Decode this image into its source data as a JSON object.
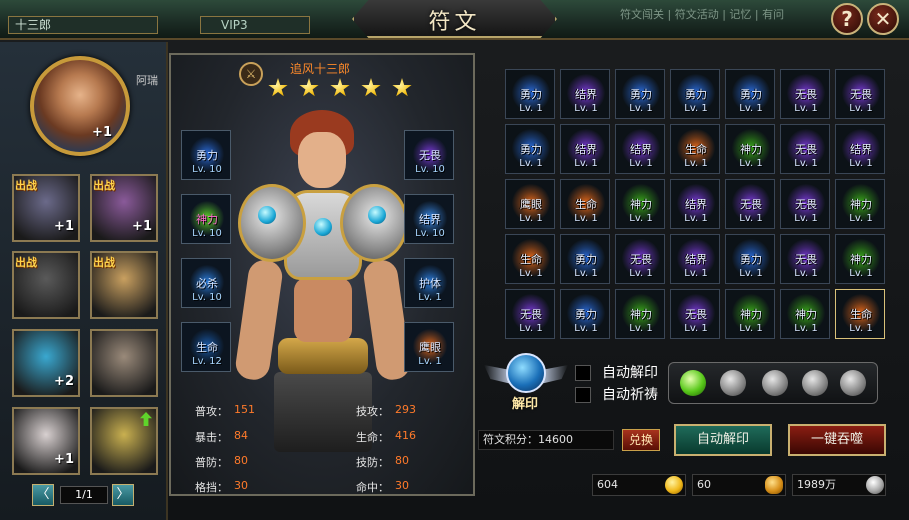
{
  "header": {
    "player_name": "十三郎",
    "vip": "VIP3",
    "title": "符文",
    "bg_text": "符文闯关 | 符文活动 | 记忆 | 有问",
    "help_label": "?",
    "close_label": "✕"
  },
  "left": {
    "main_hero": {
      "plus": "+1",
      "name": "阿瑞"
    },
    "heroes": [
      {
        "tag": "出战",
        "plus": "+1",
        "color": "#6b6a8a"
      },
      {
        "tag": "出战",
        "plus": "+1",
        "color": "#8a5a9a"
      },
      {
        "tag": "出战",
        "plus": "",
        "color": "#5a5a5a"
      },
      {
        "tag": "出战",
        "plus": "",
        "color": "#c9a060"
      },
      {
        "tag": "",
        "plus": "+2",
        "color": "#3aa8d0"
      },
      {
        "tag": "",
        "plus": "",
        "color": "#9a8a7a"
      },
      {
        "tag": "",
        "plus": "+1",
        "color": "#d8d0d0"
      },
      {
        "tag": "",
        "plus": "",
        "color": "#c9b050",
        "upgrade": true
      }
    ],
    "pager": {
      "prev": "〈",
      "text": "1/1",
      "next": "〉"
    }
  },
  "hero": {
    "name": "追风十三郎",
    "stars": 5,
    "equip": [
      {
        "name": "勇力",
        "lv": "Lv. 10",
        "color": "#2a6ad8",
        "name_color": "#d8e6ff"
      },
      {
        "name": "神力",
        "lv": "Lv. 10",
        "color": "#5fd42a",
        "name_color": "#ff6ad0"
      },
      {
        "name": "必杀",
        "lv": "Lv. 10",
        "color": "#2a7ad8",
        "name_color": "#d8e6ff"
      },
      {
        "name": "生命",
        "lv": "Lv. 12",
        "color": "#1a5aa8",
        "name_color": "#d8e6ff"
      },
      {
        "name": "无畏",
        "lv": "Lv. 10",
        "color": "#7a3ad8",
        "name_color": "#d8e6ff"
      },
      {
        "name": "结界",
        "lv": "Lv. 10",
        "color": "#3a8ae8",
        "name_color": "#d8e6ff"
      },
      {
        "name": "护体",
        "lv": "Lv. 1",
        "color": "#2a7ad8",
        "name_color": "#d8e6ff"
      },
      {
        "name": "鹰眼",
        "lv": "Lv. 1",
        "color": "#e0661a",
        "name_color": "#d8e6ff"
      }
    ],
    "stats": [
      {
        "label": "普攻：",
        "value": "151"
      },
      {
        "label": "技攻：",
        "value": "293"
      },
      {
        "label": "暴击：",
        "value": "84"
      },
      {
        "label": "生命：",
        "value": "416"
      },
      {
        "label": "普防：",
        "value": "80"
      },
      {
        "label": "技防：",
        "value": "80"
      },
      {
        "label": "格挡：",
        "value": "30"
      },
      {
        "label": "命中：",
        "value": "30"
      }
    ]
  },
  "runes": [
    {
      "name": "勇力",
      "lv": "Lv. 1",
      "color": "#2a6ad8"
    },
    {
      "name": "结界",
      "lv": "Lv. 1",
      "color": "#7a3ad8"
    },
    {
      "name": "勇力",
      "lv": "Lv. 1",
      "color": "#2a6ad8"
    },
    {
      "name": "勇力",
      "lv": "Lv. 1",
      "color": "#2a6ad8"
    },
    {
      "name": "勇力",
      "lv": "Lv. 1",
      "color": "#2a6ad8"
    },
    {
      "name": "无畏",
      "lv": "Lv. 1",
      "color": "#7a3ad8"
    },
    {
      "name": "无畏",
      "lv": "Lv. 1",
      "color": "#7a3ad8"
    },
    {
      "name": "勇力",
      "lv": "Lv. 1",
      "color": "#2a6ad8"
    },
    {
      "name": "结界",
      "lv": "Lv. 1",
      "color": "#7a3ad8"
    },
    {
      "name": "结界",
      "lv": "Lv. 1",
      "color": "#7a3ad8"
    },
    {
      "name": "生命",
      "lv": "Lv. 1",
      "color": "#e0661a"
    },
    {
      "name": "神力",
      "lv": "Lv. 1",
      "color": "#3aa81a"
    },
    {
      "name": "无畏",
      "lv": "Lv. 1",
      "color": "#7a3ad8"
    },
    {
      "name": "结界",
      "lv": "Lv. 1",
      "color": "#7a3ad8"
    },
    {
      "name": "鹰眼",
      "lv": "Lv. 1",
      "color": "#e0661a"
    },
    {
      "name": "生命",
      "lv": "Lv. 1",
      "color": "#e0661a"
    },
    {
      "name": "神力",
      "lv": "Lv. 1",
      "color": "#3aa81a"
    },
    {
      "name": "结界",
      "lv": "Lv. 1",
      "color": "#7a3ad8"
    },
    {
      "name": "无畏",
      "lv": "Lv. 1",
      "color": "#7a3ad8"
    },
    {
      "name": "无畏",
      "lv": "Lv. 1",
      "color": "#7a3ad8"
    },
    {
      "name": "神力",
      "lv": "Lv. 1",
      "color": "#3aa81a"
    },
    {
      "name": "生命",
      "lv": "Lv. 1",
      "color": "#e0661a"
    },
    {
      "name": "勇力",
      "lv": "Lv. 1",
      "color": "#2a6ad8"
    },
    {
      "name": "无畏",
      "lv": "Lv. 1",
      "color": "#7a3ad8"
    },
    {
      "name": "结界",
      "lv": "Lv. 1",
      "color": "#7a3ad8"
    },
    {
      "name": "勇力",
      "lv": "Lv. 1",
      "color": "#2a6ad8"
    },
    {
      "name": "无畏",
      "lv": "Lv. 1",
      "color": "#7a3ad8"
    },
    {
      "name": "神力",
      "lv": "Lv. 1",
      "color": "#3aa81a"
    },
    {
      "name": "无畏",
      "lv": "Lv. 1",
      "color": "#7a3ad8"
    },
    {
      "name": "勇力",
      "lv": "Lv. 1",
      "color": "#2a6ad8"
    },
    {
      "name": "神力",
      "lv": "Lv. 1",
      "color": "#3aa81a"
    },
    {
      "name": "无畏",
      "lv": "Lv. 1",
      "color": "#7a3ad8"
    },
    {
      "name": "神力",
      "lv": "Lv. 1",
      "color": "#3aa81a"
    },
    {
      "name": "神力",
      "lv": "Lv. 1",
      "color": "#3aa81a"
    },
    {
      "name": "生命",
      "lv": "Lv. 1",
      "color": "#e0661a",
      "selected": true
    }
  ],
  "controls": {
    "unseal_label": "解印",
    "auto_unseal_label": "自动解印",
    "auto_pray_label": "自动祈祷",
    "orbs_lit": 1,
    "orbs_total": 5,
    "points_label": "符文积分：",
    "points_value": "14600",
    "exchange_label": "兑换",
    "auto_unseal_button": "自动解印",
    "devour_button": "一键吞噬",
    "gold": "604",
    "ingot": "60",
    "silver": "1989万"
  }
}
